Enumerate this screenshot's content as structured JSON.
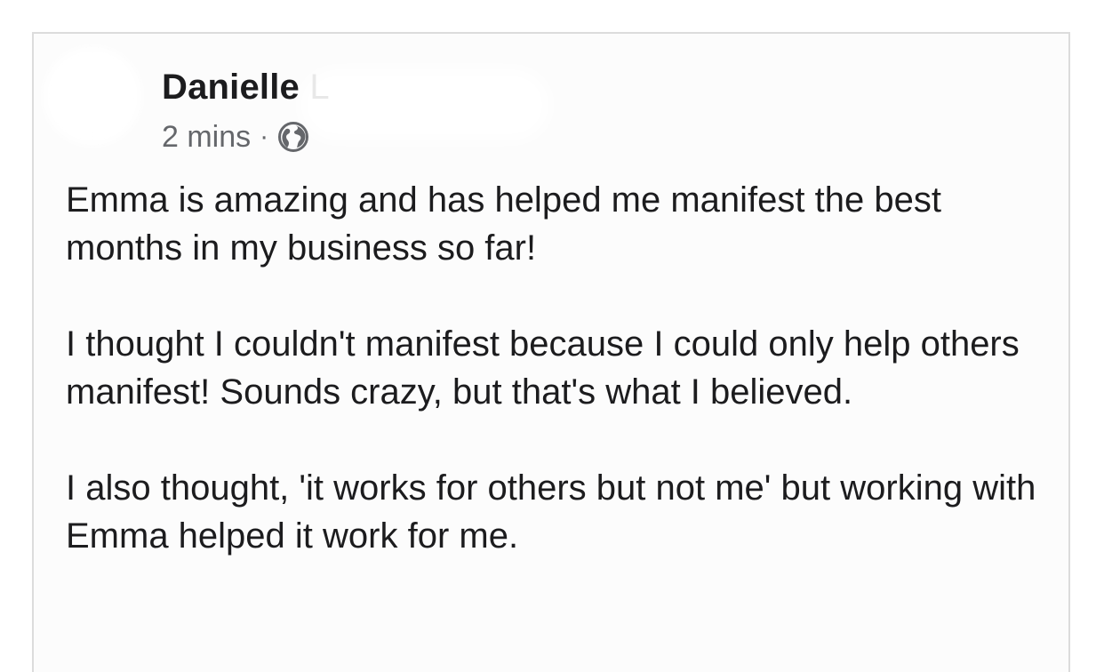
{
  "post": {
    "author": {
      "name": "Danielle",
      "name_tail": "L"
    },
    "timestamp": "2 mins",
    "separator": "·",
    "visibility_icon": "globe-icon",
    "paragraphs": [
      "Emma is amazing and has helped me manifest the best months in my business so far!",
      "I thought I couldn't manifest because I could only help others manifest! Sounds crazy, but that's what I believed.",
      "I also thought, 'it works for others but not me' but working with Emma helped it work for me."
    ]
  },
  "colors": {
    "text_primary": "#1c1c1e",
    "text_secondary": "#65676b",
    "card_border": "#dcdcdc"
  }
}
